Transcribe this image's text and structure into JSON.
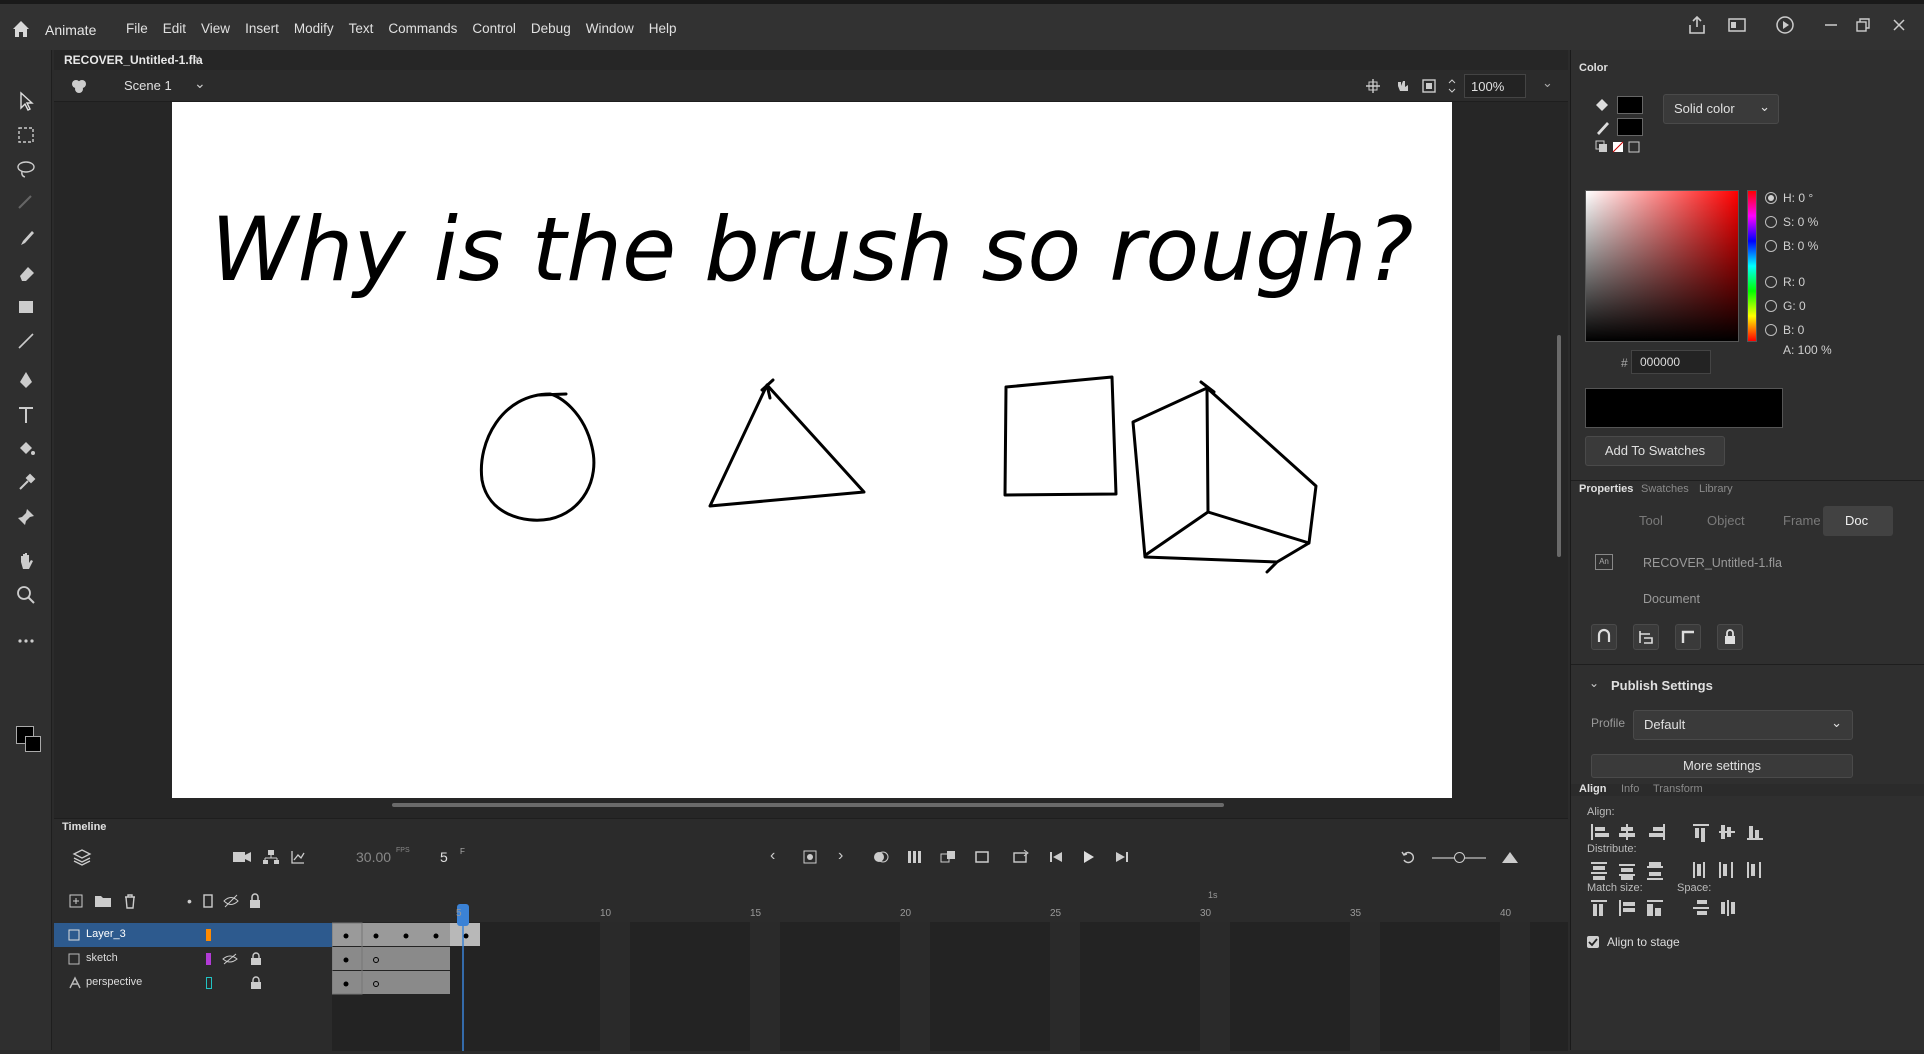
{
  "app": {
    "name": "Animate"
  },
  "menu": [
    "File",
    "Edit",
    "View",
    "Insert",
    "Modify",
    "Text",
    "Commands",
    "Control",
    "Debug",
    "Window",
    "Help"
  ],
  "document": {
    "tab_name": "RECOVER_Untitled-1.fla"
  },
  "scene": {
    "name": "Scene 1",
    "zoom": "100%"
  },
  "stage": {
    "drawing_text": "Why is the brush so rough?"
  },
  "timeline": {
    "title": "Timeline",
    "fps": "30.00",
    "fps_unit": "FPS",
    "frame": "5",
    "frame_unit": "F",
    "ruler_labels": [
      "5",
      "10",
      "15",
      "20",
      "25",
      "30",
      "35",
      "40"
    ],
    "seconds_label": "1s",
    "layers": [
      {
        "name": "Layer_3",
        "color": "#ff8a00",
        "selected": true
      },
      {
        "name": "sketch",
        "color": "#b23bd6",
        "selected": false
      },
      {
        "name": "perspective",
        "color": "#22c3c3",
        "selected": false
      }
    ]
  },
  "color_panel": {
    "title": "Color",
    "fill_type": "Solid color",
    "h": "H: 0 °",
    "s": "S: 0 %",
    "b": "B: 0 %",
    "r": "R: 0",
    "g": "G: 0",
    "b2": "B: 0",
    "a": "A: 100 %",
    "hex_label": "#",
    "hex": "000000",
    "add_swatches": "Add To Swatches",
    "swatch_color": "#000000"
  },
  "properties": {
    "tabs": [
      "Properties",
      "Swatches",
      "Library"
    ],
    "subtabs": [
      "Tool",
      "Object",
      "Frame",
      "Doc"
    ],
    "active_subtab": "Doc",
    "doc_name": "RECOVER_Untitled-1.fla",
    "doc_type": "Document",
    "publish_settings": "Publish Settings",
    "profile_label": "Profile",
    "profile_value": "Default",
    "more_settings": "More settings"
  },
  "align_panel": {
    "tabs": [
      "Align",
      "Info",
      "Transform"
    ],
    "align_label": "Align:",
    "distribute_label": "Distribute:",
    "match_size_label": "Match size:",
    "space_label": "Space:",
    "align_to_stage": "Align to stage"
  }
}
